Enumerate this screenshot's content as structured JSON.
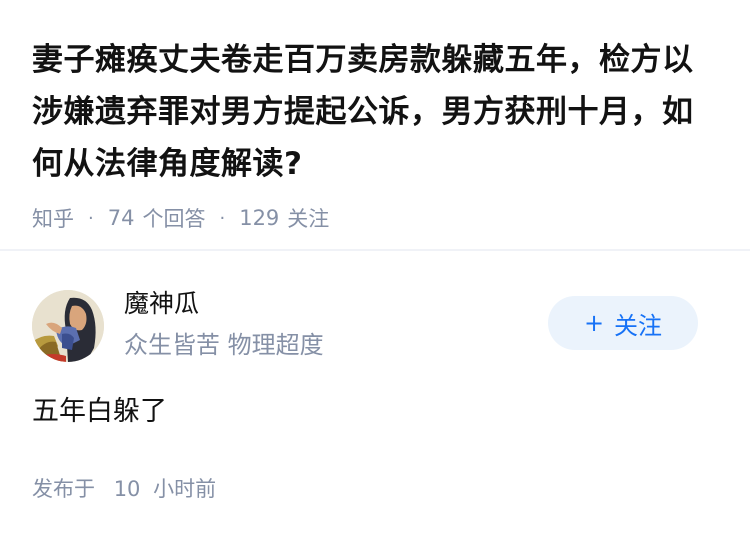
{
  "question": {
    "title": "妻子瘫痪丈夫卷走百万卖房款躲藏五年，检方以涉嫌遗弃罪对男方提起公诉，男方获刑十月，如何从法律角度解读?",
    "source": "知乎",
    "separator": "·",
    "answer_count": "74",
    "answer_label": "个回答",
    "follower_count": "129",
    "follower_label": "关注"
  },
  "author": {
    "name": "魔神瓜",
    "bio": "众生皆苦 物理超度",
    "avatar_icon": "portrait-avatar"
  },
  "follow_button": {
    "plus": "+",
    "label": "关注"
  },
  "answer": {
    "content": "五年白躲了",
    "time_prefix": "发布于",
    "time_value": "10",
    "time_unit": "小时前"
  },
  "colors": {
    "text_primary": "#121212",
    "text_secondary": "#8590a6",
    "accent": "#1772f6",
    "button_bg": "#ebf3fc",
    "divider": "#f0f2f7"
  }
}
